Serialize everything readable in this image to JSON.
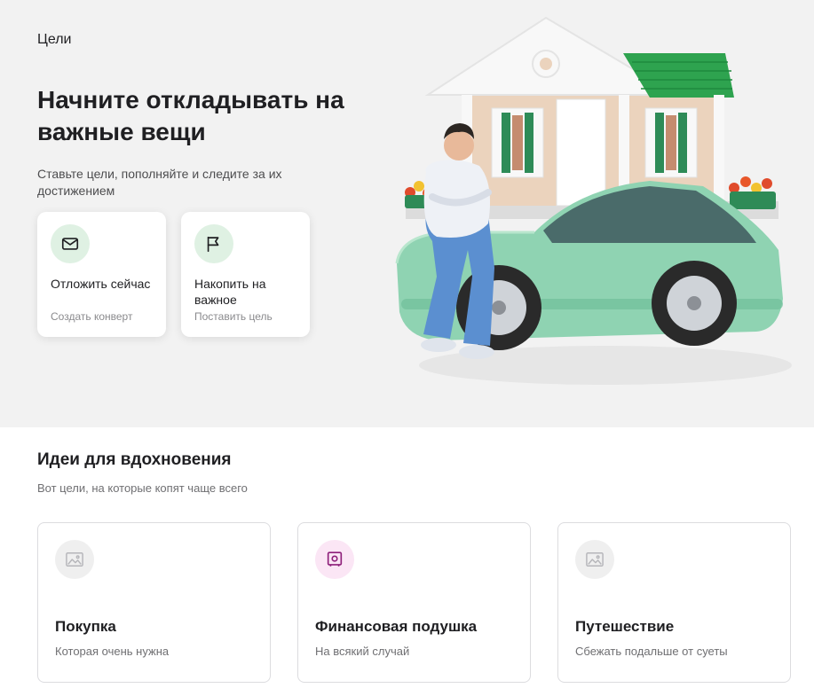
{
  "breadcrumb": "Цели",
  "hero": {
    "title": "Начните откладывать на важные вещи",
    "subtitle": "Ставьте цели, пополняйте и следите за их достижением"
  },
  "actions": [
    {
      "title": "Отложить сейчас",
      "subtitle": "Создать конверт",
      "icon": "envelope-icon"
    },
    {
      "title": "Накопить на важное",
      "subtitle": "Поставить цель",
      "icon": "flag-icon"
    }
  ],
  "ideas": {
    "title": "Идеи для вдохновения",
    "subtitle": "Вот цели, на которые копят чаще всего",
    "items": [
      {
        "title": "Покупка",
        "subtitle": "Которая очень нужна",
        "icon": "image-placeholder-icon"
      },
      {
        "title": "Финансовая подушка",
        "subtitle": "На всякий случай",
        "icon": "safe-icon"
      },
      {
        "title": "Путешествие",
        "subtitle": "Сбежать подальше от суеты",
        "icon": "image-placeholder-icon"
      }
    ]
  },
  "colors": {
    "hero_bg": "#f2f2f2",
    "accent_green_soft": "#dff1e3",
    "accent_pink_soft": "#fbe6f5",
    "safe_icon": "#8e1f7a"
  }
}
